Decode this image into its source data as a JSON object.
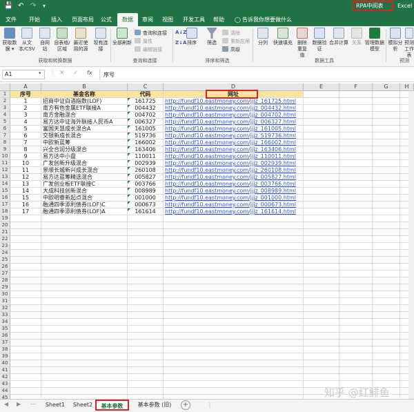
{
  "title_bar": {
    "rpa_tab": "RPA中间表",
    "app_name": "Excel"
  },
  "menu": {
    "items": [
      "文件",
      "开始",
      "插入",
      "页面布局",
      "公式",
      "数据",
      "审阅",
      "视图",
      "开发工具",
      "帮助"
    ],
    "active": "数据",
    "tell_me": "告诉我你想要做什么"
  },
  "ribbon": {
    "get_data": [
      "获取数据 ▾",
      "从文本/CSV",
      "自网站",
      "自表格/区域",
      "最近使用的源",
      "现有连接"
    ],
    "group_get": "获取和转换数据",
    "refresh_all": "全部刷新",
    "queries_connections": "查询和连接",
    "properties": "属性",
    "edit_links": "编辑链接",
    "group_queries": "查询和连接",
    "sort": "排序",
    "filter": "筛选",
    "clear": "清除",
    "reapply": "重新应用",
    "advanced": "高级",
    "group_sort": "排序和筛选",
    "tools": [
      "分列",
      "快速填充",
      "删除重复值",
      "数据验证",
      "合并计算",
      "关系",
      "管理数据模型"
    ],
    "group_tools": "数据工具",
    "forecast": [
      "模拟分析",
      "预测工作表"
    ],
    "group_forecast": "预测"
  },
  "formula_bar": {
    "name_box": "A1",
    "content": "序号"
  },
  "columns": [
    "A",
    "B",
    "C",
    "D",
    "E",
    "F",
    "G",
    "H"
  ],
  "headers": [
    "序号",
    "基金名称",
    "代码",
    "网址"
  ],
  "rows": [
    [
      "1",
      "招商中证白酒指数(LOF)",
      "161725",
      "http://fundf10.eastmoney.com/jjjz_161725.html"
    ],
    [
      "2",
      "南方有色金属ETF联接A",
      "004432",
      "http://fundf10.eastmoney.com/jjjz_004432.html"
    ],
    [
      "3",
      "南方金融混合",
      "004702",
      "http://fundf10.eastmoney.com/jjjz_004702.html"
    ],
    [
      "4",
      "易方达中证海外联接人民币A",
      "006327",
      "http://fundf10.eastmoney.com/jjjz_006327.html"
    ],
    [
      "5",
      "富国天慧成长混合A",
      "161005",
      "http://fundf10.eastmoney.com/jjjz_161005.html"
    ],
    [
      "6",
      "交银新成长混合",
      "519736",
      "http://fundf10.eastmoney.com/jjjz_519736.html"
    ],
    [
      "7",
      "中欧新蓝筹",
      "166002",
      "http://fundf10.eastmoney.com/jjjz_166002.html"
    ],
    [
      "8",
      "兴全合润分级混合",
      "163406",
      "http://fundf10.eastmoney.com/jjjz_163406.html"
    ],
    [
      "9",
      "易方达中小盘",
      "110011",
      "http://fundf10.eastmoney.com/jjjz_110011.html"
    ],
    [
      "10",
      "广发创新升级混合",
      "002939",
      "http://fundf10.eastmoney.com/jjjz_002939.html"
    ],
    [
      "11",
      "景顺长城新兴成长混合",
      "260108",
      "http://fundf10.eastmoney.com/jjjz_260108.html"
    ],
    [
      "12",
      "易方达蓝筹精选混合",
      "005827",
      "http://fundf10.eastmoney.com/jjjz_005827.html"
    ],
    [
      "13",
      "广发创业板ETF联接C",
      "003766",
      "http://fundf10.eastmoney.com/jjjz_003766.html"
    ],
    [
      "14",
      "大成科技创新混合",
      "008989",
      "http://fundf10.eastmoney.com/jjjz_008989.html"
    ],
    [
      "15",
      "中欧明睿新起点混合",
      "001000",
      "http://fundf10.eastmoney.com/jjjz_001000.html"
    ],
    [
      "16",
      "融通四季添利债券(LOF)C",
      "000673",
      "http://fundf10.eastmoney.com/jjjz_000673.html"
    ],
    [
      "17",
      "融通四季添利债券(LOF)A",
      "161614",
      "http://fundf10.eastmoney.com/jjjz_161614.html"
    ]
  ],
  "sheets": [
    "Sheet1",
    "Sheet2",
    "基本参数",
    "基本参数 (旧)"
  ],
  "active_sheet": "基本参数",
  "watermark": "知乎 @红鲱鱼",
  "colors": {
    "accent": "#217346",
    "header_fill": "#fbe59e",
    "highlight": "#e02020",
    "link": "#2f54c7"
  }
}
